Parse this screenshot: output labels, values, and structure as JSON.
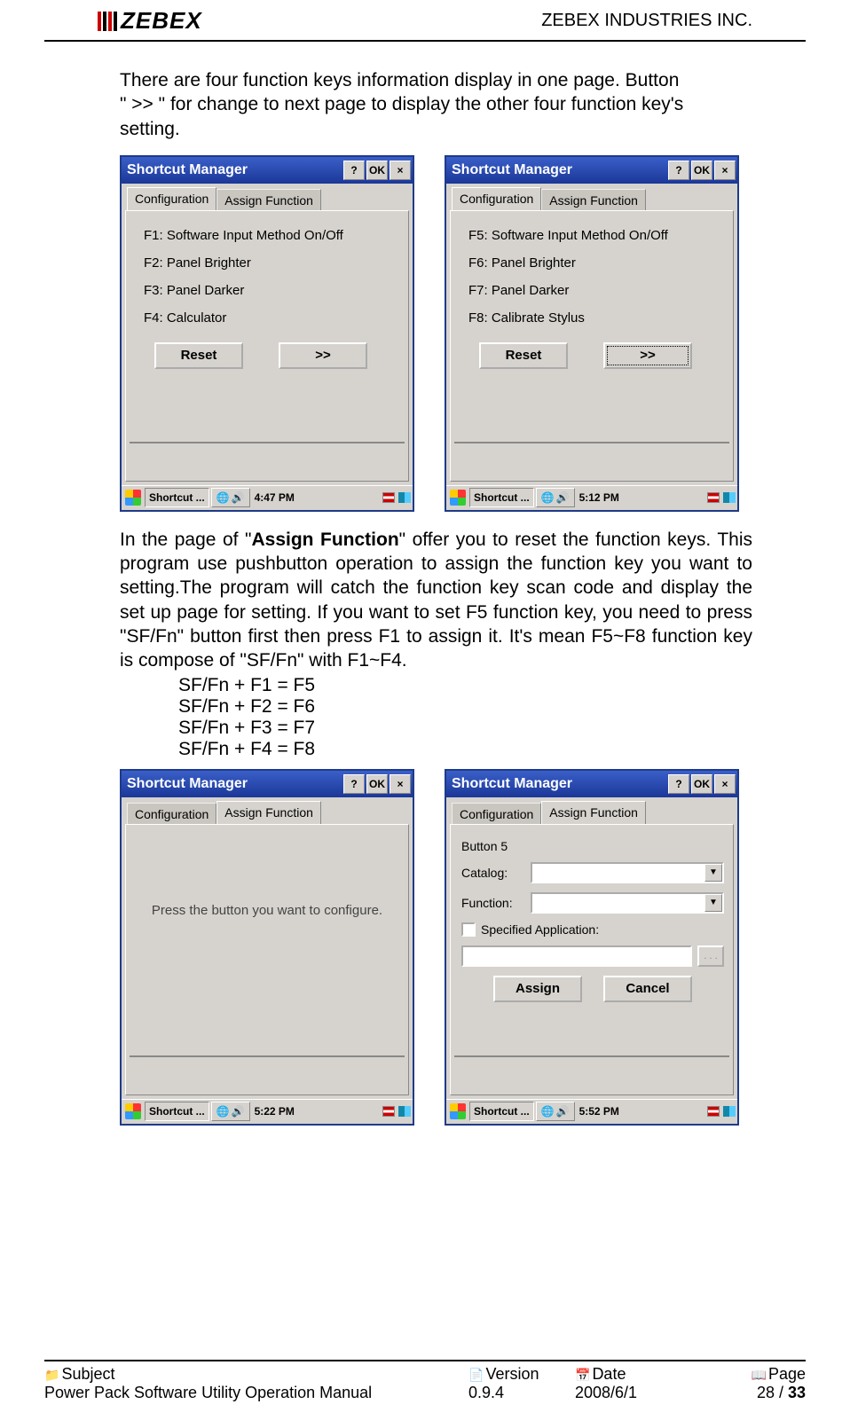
{
  "header": {
    "brand": "ZEBEX",
    "company": "ZEBEX INDUSTRIES INC."
  },
  "para1_l1": "There are four function keys information display in one page. Button",
  "para1_l2": "\" >> \" for change to next page to display the other four function key's",
  "para1_l3": "setting.",
  "dialog": {
    "title": "Shortcut Manager",
    "btn_help": "?",
    "btn_ok": "OK",
    "btn_close": "×",
    "tab_config": "Configuration",
    "tab_assign": "Assign Function",
    "reset": "Reset",
    "next": ">>",
    "assign": "Assign",
    "cancel": "Cancel"
  },
  "config_page1": [
    "F1:  Software Input Method On/Off",
    "F2:  Panel Brighter",
    "F3:  Panel Darker",
    "F4:  Calculator"
  ],
  "config_page2": [
    "F5:  Software Input Method On/Off",
    "F6:  Panel Brighter",
    "F7:  Panel Darker",
    "F8:  Calibrate Stylus"
  ],
  "taskbar_app": "Shortcut ...",
  "time1": "4:47 PM",
  "time2": "5:12 PM",
  "time3": "5:22 PM",
  "time4": "5:52 PM",
  "para2_a": "In the page of \"",
  "para2_bold": "Assign Function",
  "para2_b": "\" offer you to reset the function keys. This program use pushbutton operation to assign the function key you want to setting.The program will catch the function key scan code and display the set up page for setting. If you want to set F5 function key, you need to press \"SF/Fn\" button first then press F1 to assign it. It's mean F5~F8 function key is compose of \"SF/Fn\" with F1~F4.",
  "map": [
    "SF/Fn + F1 = F5",
    "SF/Fn + F2 = F6",
    "SF/Fn + F3 = F7",
    "SF/Fn + F4 = F8"
  ],
  "assign_prompt": "Press the button you want to configure.",
  "form": {
    "button_label": "Button   5",
    "catalog": "Catalog:",
    "function": "Function:",
    "spec_app": "Specified Application:"
  },
  "footer": {
    "subj_label": "Subject",
    "subj_value": "Power Pack Software Utility Operation Manual",
    "ver_label": "Version",
    "ver_value": "0.9.4",
    "date_label": "Date",
    "date_value": "2008/6/1",
    "page_label": "Page",
    "page_value": "28 / 33",
    "page_total": "33"
  }
}
